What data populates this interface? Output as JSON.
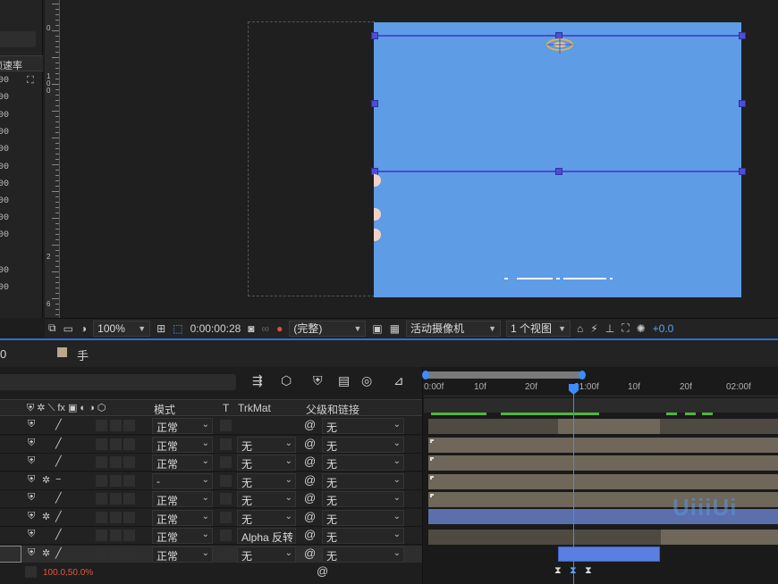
{
  "left_panel": {
    "header": "帧速率",
    "frame_values": [
      "00",
      "00",
      "00",
      "00",
      "00",
      "00",
      "00",
      "00",
      "00",
      "00",
      "00",
      "00"
    ]
  },
  "ruler": {
    "labels": [
      "0",
      "100",
      "2",
      "6"
    ]
  },
  "viewer_toolbar": {
    "zoom": "100%",
    "timecode": "0:00:00:28",
    "resolution": "(完整)",
    "camera": "活动摄像机",
    "views": "1 个视图",
    "exposure": "+0.0"
  },
  "timeline": {
    "tab_prefix": "0",
    "tab_name": "手",
    "columns": {
      "mode": "模式",
      "t": "T",
      "trkmat": "TrkMat",
      "parent": "父级和链接"
    },
    "ruler_labels": [
      "0:00f",
      "10f",
      "20f",
      "01:00f",
      "10f",
      "20f",
      "02:00f"
    ],
    "layers": [
      {
        "mode": "正常",
        "trkmat": "",
        "parent": "无"
      },
      {
        "mode": "正常",
        "trkmat": "无",
        "parent": "无"
      },
      {
        "mode": "正常",
        "trkmat": "无",
        "parent": "无"
      },
      {
        "mode": "-",
        "trkmat": "无",
        "parent": "无"
      },
      {
        "mode": "正常",
        "trkmat": "无",
        "parent": "无"
      },
      {
        "mode": "正常",
        "trkmat": "无",
        "parent": "无"
      },
      {
        "mode": "正常",
        "trkmat": "Alpha 反转",
        "parent": "无"
      },
      {
        "mode": "正常",
        "trkmat": "无",
        "parent": "无"
      }
    ],
    "property_value": "100.0,50.0%",
    "watermark": "UiiiUi"
  },
  "colors": {
    "accent": "#3c8cff",
    "layer_blue": "#5e9ce6",
    "keyframe_text": "#e2573f"
  }
}
